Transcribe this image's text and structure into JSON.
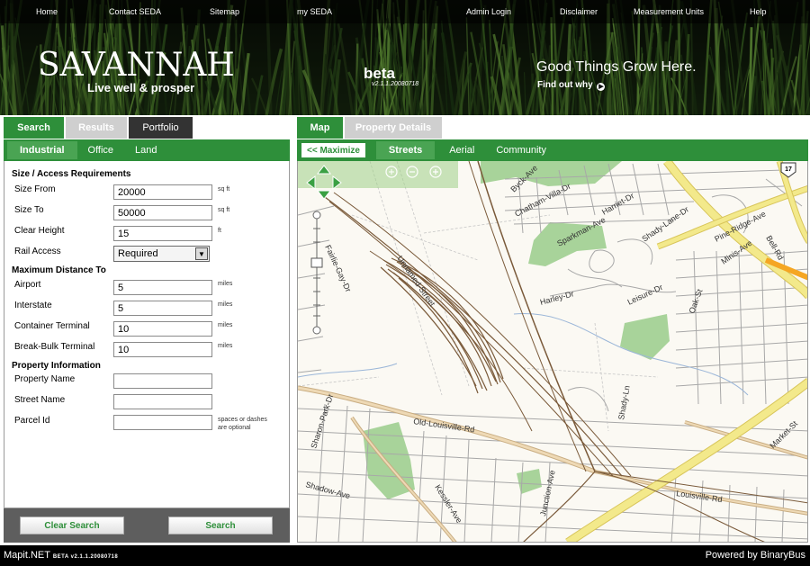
{
  "topnav": [
    "Home",
    "Contact SEDA",
    "Sitemap",
    "my SEDA",
    "Admin Login",
    "Disclaimer",
    "Measurement Units",
    "Help"
  ],
  "header": {
    "logo": "Savannah",
    "logo_sub": "Live well & prosper",
    "beta": "beta",
    "version": "v2.1.1.20080718",
    "tagline": "Good Things Grow Here.",
    "findout": "Find out why"
  },
  "left": {
    "tabs": [
      "Search",
      "Results",
      "Portfolio"
    ],
    "subtabs": [
      "Industrial",
      "Office",
      "Land"
    ],
    "sections": {
      "size": "Size / Access Requirements",
      "distance": "Maximum Distance To",
      "property": "Property Information"
    },
    "fields": {
      "size_from": {
        "label": "Size From",
        "value": "20000",
        "unit": "sq ft"
      },
      "size_to": {
        "label": "Size To",
        "value": "50000",
        "unit": "sq ft"
      },
      "clear_height": {
        "label": "Clear Height",
        "value": "15",
        "unit": "ft"
      },
      "rail_access": {
        "label": "Rail Access",
        "value": "Required"
      },
      "airport": {
        "label": "Airport",
        "value": "5",
        "unit": "miles"
      },
      "interstate": {
        "label": "Interstate",
        "value": "5",
        "unit": "miles"
      },
      "container": {
        "label": "Container Terminal",
        "value": "10",
        "unit": "miles"
      },
      "breakbulk": {
        "label": "Break-Bulk Terminal",
        "value": "10",
        "unit": "miles"
      },
      "property_name": {
        "label": "Property Name",
        "value": ""
      },
      "street_name": {
        "label": "Street Name",
        "value": ""
      },
      "parcel_id": {
        "label": "Parcel Id",
        "value": "",
        "unit": "spaces or dashes are optional"
      }
    },
    "buttons": {
      "clear": "Clear Search",
      "search": "Search"
    }
  },
  "right": {
    "tabs": [
      "Map",
      "Property Details"
    ],
    "maximize": "<< Maximize",
    "maptypes": [
      "Streets",
      "Aerial",
      "Community"
    ],
    "streets": [
      "Unnamed-Street",
      "Fairlie-Gay-Dr",
      "Old-Louisville-Rd",
      "Louisville-Rd",
      "Kessler-Ave",
      "Junction-Ave",
      "Shady-Ln",
      "Harley-Dr",
      "Leisure-Dr",
      "Sparkman-Ave",
      "Chatham-Villa-Dr",
      "Pine-Ridge-Ave",
      "Shady-Lane-Dr",
      "Byck-Ave",
      "Sharon-Park-Dr",
      "Shadow-Ave",
      "Market-St",
      "Minis-Ave",
      "Bell-Rd",
      "Oak-St",
      "Harriet-Dr"
    ],
    "route_shield": "17"
  },
  "footer": {
    "left": "Mapit.NET",
    "left_ver": "BETA v2.1.1.20080718",
    "right": "Powered by BinaryBus"
  },
  "colors": {
    "accent_green": "#2e8f3a",
    "highway_yellow": "#f3e98b",
    "rail_brown": "#7a5a3a",
    "park_green": "#a8d39a"
  }
}
